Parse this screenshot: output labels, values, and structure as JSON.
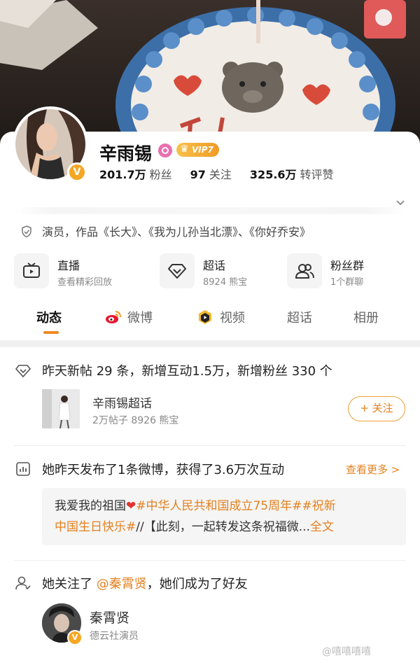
{
  "profile": {
    "name": "辛雨锡",
    "vip_label": "VIP7",
    "verified_label": "V",
    "stats": [
      {
        "num": "201.7万",
        "label": "粉丝"
      },
      {
        "num": "97",
        "label": "关注"
      },
      {
        "num": "325.6万",
        "label": "转评赞"
      }
    ],
    "bio": "演员，作品《长大》、《我为儿孙当北漂》、《你好乔安》"
  },
  "functions": [
    {
      "title": "直播",
      "sub": "查看精彩回放",
      "icon": "tv-icon"
    },
    {
      "title": "超话",
      "sub": "8924 熊宝",
      "icon": "diamond-icon"
    },
    {
      "title": "粉丝群",
      "sub": "1个群聊",
      "icon": "group-icon"
    }
  ],
  "tabs": [
    {
      "label": "动态",
      "active": true
    },
    {
      "label": "微博",
      "icon": "weibo-icon"
    },
    {
      "label": "视频",
      "icon": "video-icon"
    },
    {
      "label": "超话"
    },
    {
      "label": "相册"
    }
  ],
  "feed": {
    "activity": "昨天新帖 29 条，新增互动1.5万，新增粉丝 330 个",
    "topic": {
      "title": "辛雨锡超话",
      "sub": "2万帖子 8926 熊宝",
      "follow_label": "+ 关注"
    },
    "post_summary": "她昨天发布了1条微博，获得了3.6万次互动",
    "more_label": "查看更多 >",
    "quote": {
      "prefix": "我爱我的祖国",
      "heart": "❤",
      "hashtag1": "#中华人民共和国成立75周年#",
      "hashtag2_a": "#祝新",
      "hashtag2_b": "中国生日快乐#",
      "line2_rest": "//【此刻，一起转发这条祝福微...",
      "full_text": "全文"
    },
    "friend_prefix": "她关注了",
    "friend_mention": "@秦霄贤",
    "friend_suffix": "，她们成为了好友",
    "friend": {
      "name": "秦霄贤",
      "desc": "德云社演员"
    }
  },
  "watermark": "@嘻嘻嘻嘻"
}
